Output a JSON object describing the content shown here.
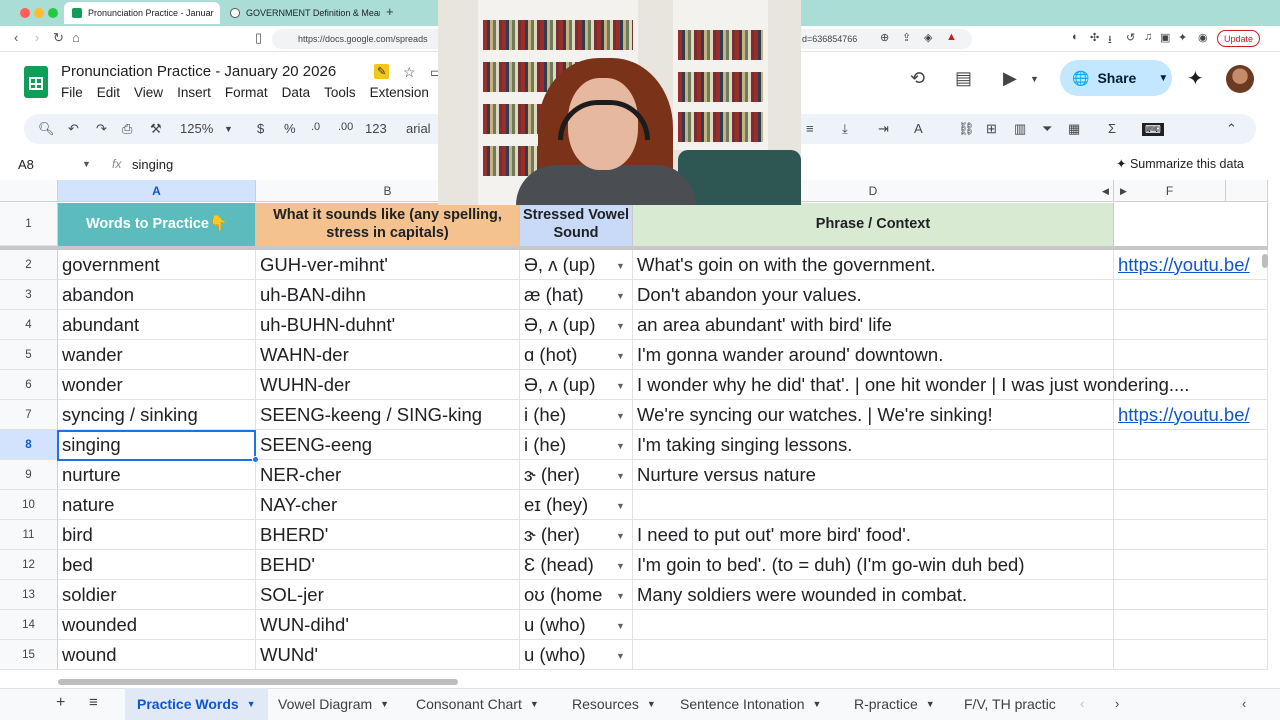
{
  "browser": {
    "tabs": [
      {
        "title": "Pronunciation Practice - Januar",
        "active": true
      },
      {
        "title": "GOVERNMENT Definition & Meanin",
        "active": false
      }
    ],
    "url": "https://docs.google.com/spreads",
    "url_suffix": "d=636854766",
    "update_label": "Update",
    "colors": {
      "tabbar": "#a9ddd6",
      "accent": "#1a73e8"
    }
  },
  "doc": {
    "title": "Pronunciation Practice - January 20 2026",
    "menu": [
      "File",
      "Edit",
      "View",
      "Insert",
      "Format",
      "Data",
      "Tools",
      "Extension"
    ],
    "share_label": "Share"
  },
  "toolbar": {
    "zoom": "125%",
    "currency": "$",
    "percent": "%",
    "dec_decrease": ".0",
    "dec_increase": ".00",
    "number_format": "123",
    "font": "arial"
  },
  "formula_bar": {
    "cell_ref": "A8",
    "fx": "fx",
    "value": "singing",
    "summarize_label": "Summarize this data"
  },
  "columns": [
    "A",
    "B",
    "D",
    "F"
  ],
  "headers": {
    "a": "Words to Practice👇",
    "b": "What it sounds like (any spelling, stress in capitals)",
    "c": "Stressed Vowel Sound",
    "d": "Phrase / Context"
  },
  "rows": [
    {
      "n": "1"
    },
    {
      "n": "2",
      "word": "government",
      "sound": "GUH-ver-mihnt'",
      "vowel": "Ə, ʌ (up)",
      "phrase": "What's goin on with the government.",
      "link": "https://youtu.be/"
    },
    {
      "n": "3",
      "word": "abandon",
      "sound": "uh-BAN-dihn",
      "vowel": "æ (hat)",
      "phrase": "Don't abandon your values.",
      "link": ""
    },
    {
      "n": "4",
      "word": "abundant",
      "sound": "uh-BUHN-duhnt'",
      "vowel": "Ə, ʌ (up)",
      "phrase": "an area abundant' with bird' life",
      "link": ""
    },
    {
      "n": "5",
      "word": "wander",
      "sound": "WAHN-der",
      "vowel": "ɑ (hot)",
      "phrase": "I'm gonna wander around' downtown.",
      "link": ""
    },
    {
      "n": "6",
      "word": "wonder",
      "sound": "WUHN-der",
      "vowel": "Ə, ʌ (up)",
      "phrase": "I wonder why he did' that'. | one hit wonder | I was just wondering....",
      "link": ""
    },
    {
      "n": "7",
      "word": "syncing / sinking",
      "sound": "SEENG-keeng / SING-king",
      "vowel": "i (he)",
      "phrase": "We're syncing our watches. | We're sinking!",
      "link": "https://youtu.be/"
    },
    {
      "n": "8",
      "word": "singing",
      "sound": "SEENG-eeng",
      "vowel": "i (he)",
      "phrase": "I'm taking singing lessons.",
      "link": ""
    },
    {
      "n": "9",
      "word": "nurture",
      "sound": "NER-cher",
      "vowel": "ɝ (her)",
      "phrase": "Nurture versus nature",
      "link": ""
    },
    {
      "n": "10",
      "word": "nature",
      "sound": "NAY-cher",
      "vowel": "eɪ (hey)",
      "phrase": "",
      "link": ""
    },
    {
      "n": "11",
      "word": "bird",
      "sound": "BHERD'",
      "vowel": "ɝ (her)",
      "phrase": "I need to put out' more bird' food'.",
      "link": ""
    },
    {
      "n": "12",
      "word": "bed",
      "sound": "BEHD'",
      "vowel": "Ɛ (head)",
      "phrase": "I'm goin to bed'.   (to = duh)  (I'm go-win duh bed)",
      "link": ""
    },
    {
      "n": "13",
      "word": "soldier",
      "sound": "SOL-jer",
      "vowel": "oʊ (home",
      "phrase": "Many soldiers were wounded in combat.",
      "link": ""
    },
    {
      "n": "14",
      "word": "wounded",
      "sound": "WUN-dihd'",
      "vowel": "u (who)",
      "phrase": "",
      "link": ""
    },
    {
      "n": "15",
      "word": "wound",
      "sound": "WUNd'",
      "vowel": "u (who)",
      "phrase": "",
      "link": ""
    }
  ],
  "sheet_tabs": [
    "Practice Words",
    "Vowel Diagram",
    "Consonant Chart",
    "Resources",
    "Sentence Intonation",
    "R-practice",
    "F/V, TH practic"
  ],
  "header_colors": {
    "a": "#5cbcbd",
    "b": "#f3c28e",
    "c": "#c9daf8",
    "d": "#d9ead3"
  }
}
